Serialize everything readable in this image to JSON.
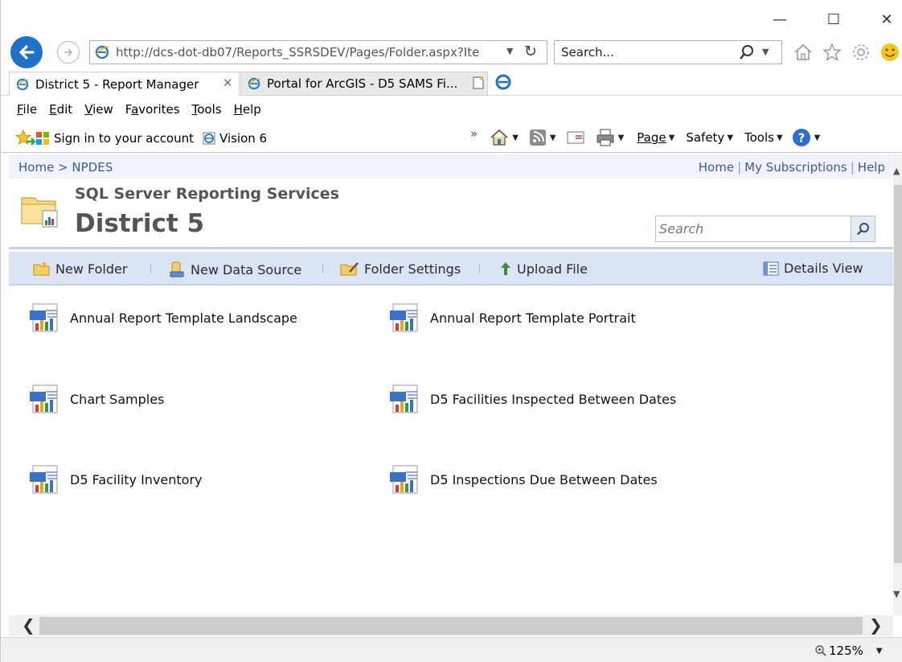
{
  "window": {
    "controls": {
      "minimize": "—",
      "maximize": "☐",
      "close": "✕"
    }
  },
  "address_bar": {
    "url": "http://dcs-dot-db07/Reports_SSRSDEV/Pages/Folder.aspx?Ite",
    "search_placeholder": "Search..."
  },
  "tabs": [
    {
      "label": "District 5 - Report Manager",
      "active": true
    },
    {
      "label": "Portal for ArcGIS - D5 SAMS Fi...",
      "active": false
    }
  ],
  "menu": {
    "items": [
      {
        "label": "File",
        "accel": "F",
        "rest": "ile"
      },
      {
        "label": "Edit",
        "accel": "E",
        "rest": "dit"
      },
      {
        "label": "View",
        "accel": "V",
        "rest": "iew"
      },
      {
        "label": "Favorites",
        "accel": "a",
        "pre": "F",
        "rest": "vorites"
      },
      {
        "label": "Tools",
        "accel": "T",
        "rest": "ools"
      },
      {
        "label": "Help",
        "accel": "H",
        "rest": "elp"
      }
    ]
  },
  "favorites_bar": {
    "sign_in": "Sign in to your account",
    "vision": "Vision 6",
    "overflow": "»"
  },
  "command_bar": {
    "page": "Page",
    "safety": "Safety",
    "tools": "Tools"
  },
  "ssrs": {
    "breadcrumb": "Home > NPDES",
    "toplinks": {
      "home": "Home",
      "subscriptions": "My Subscriptions",
      "help": "Help",
      "sep": "|"
    },
    "app_title": "SQL Server Reporting Services",
    "page_title": "District 5",
    "search_placeholder": "Search",
    "toolbar": {
      "new_folder": "New Folder",
      "new_data_source": "New Data Source",
      "folder_settings": "Folder Settings",
      "upload_file": "Upload File",
      "details_view": "Details View"
    },
    "reports": [
      "Annual Report Template Landscape",
      "Annual Report Template Portrait",
      "Chart Samples",
      "D5 Facilities Inspected Between Dates",
      "D5 Facility Inventory",
      "D5 Inspections Due Between Dates"
    ]
  },
  "status_bar": {
    "zoom": "125%"
  },
  "colors": {
    "accent_blue": "#1e73c8",
    "ssrs_link": "#3d5a8f",
    "toolbar_bg": "#dbe4f5"
  }
}
